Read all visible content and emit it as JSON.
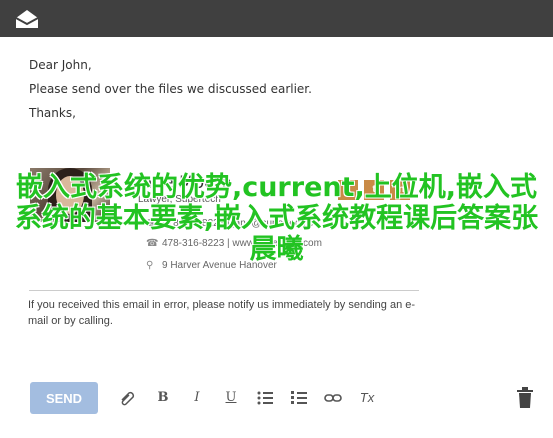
{
  "email": {
    "greeting": "Dear John,",
    "line1": "Please send over the files we discussed earlier.",
    "line2": "Thanks,"
  },
  "signature": {
    "name": "Jane Moore",
    "role": "Lawyer, Supertech",
    "phone1": "478-316-8223 | jane@supertech.co",
    "phone2": "478-316-8223 | www.supertech.com",
    "address": "9 Harver Avenue Hanover",
    "social": [
      "f",
      "t",
      "in"
    ]
  },
  "overlay_text": "嵌入式系统的优势,current,上位机,嵌入式系统的基本要素,嵌入式系统教程课后答案张晨曦",
  "disclaimer": "If you received this email in error, please notify us immediately by sending an e-mail or by calling.",
  "toolbar": {
    "send_label": "SEND",
    "bold": "B",
    "italic": "I",
    "underline": "U",
    "clear": "Tx"
  },
  "icons": [
    "mail-icon",
    "attach-icon",
    "bulleted-list-icon",
    "numbered-list-icon",
    "link-icon",
    "trash-icon"
  ],
  "colors": {
    "topbar": "#404040",
    "send_button": "#a3bde0",
    "overlay": "#22c322",
    "social": "#c98a46"
  }
}
